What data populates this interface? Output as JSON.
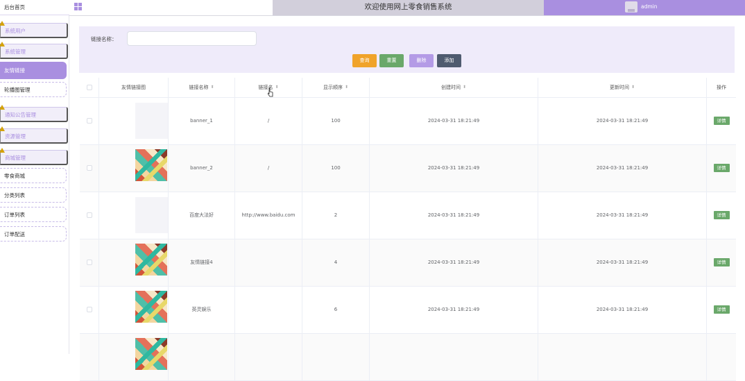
{
  "app_title": "欢迎使用网上零食销售系统",
  "user": {
    "name": "admin"
  },
  "sidebar": {
    "home": "后台首页",
    "items": [
      {
        "label": "系统用户",
        "type": "group"
      },
      {
        "label": "系统管理",
        "type": "group"
      },
      {
        "label": "友情链接",
        "type": "active"
      },
      {
        "label": "轮播图管理",
        "type": "plain"
      },
      {
        "label": "通知公告管理",
        "type": "group"
      },
      {
        "label": "资源管理",
        "type": "group"
      },
      {
        "label": "商城管理",
        "type": "group"
      },
      {
        "label": "零食商城",
        "type": "plain"
      },
      {
        "label": "分类列表",
        "type": "plain"
      },
      {
        "label": "订单列表",
        "type": "plain"
      },
      {
        "label": "订单配送",
        "type": "plain"
      }
    ]
  },
  "search": {
    "label": "链接名称：",
    "placeholder": "",
    "value": ""
  },
  "buttons": {
    "query": "查询",
    "reset": "重置",
    "delete": "删除",
    "add": "添加"
  },
  "table": {
    "columns": [
      "友情链接图",
      "链接名称",
      "链接名",
      "显示顺序",
      "创建时间",
      "更新时间",
      "操作"
    ],
    "rows": [
      {
        "image": "blank",
        "name": "banner_1",
        "url": "/",
        "order": "100",
        "created": "2024-03-31 18:21:49",
        "updated": "2024-03-31 18:21:49",
        "action": "详情"
      },
      {
        "image": "photo",
        "name": "banner_2",
        "url": "/",
        "order": "100",
        "created": "2024-03-31 18:21:49",
        "updated": "2024-03-31 18:21:49",
        "action": "详情"
      },
      {
        "image": "blank",
        "name": "百度大法好",
        "url": "http://www.baidu.com",
        "order": "2",
        "created": "2024-03-31 18:21:49",
        "updated": "2024-03-31 18:21:49",
        "action": "详情"
      },
      {
        "image": "photo",
        "name": "友情链接4",
        "url": "",
        "order": "4",
        "created": "2024-03-31 18:21:49",
        "updated": "2024-03-31 18:21:49",
        "action": "详情"
      },
      {
        "image": "photo",
        "name": "英灵娱乐",
        "url": "",
        "order": "6",
        "created": "2024-03-31 18:21:49",
        "updated": "2024-03-31 18:21:49",
        "action": "详情"
      },
      {
        "image": "photo",
        "name": "",
        "url": "",
        "order": "",
        "created": "",
        "updated": "",
        "action": ""
      }
    ]
  },
  "colors": {
    "accent": "#a98fe0",
    "query": "#f0a32a",
    "reset": "#6aa86a",
    "delete": "#b49be6",
    "add": "#4f5b6f"
  }
}
